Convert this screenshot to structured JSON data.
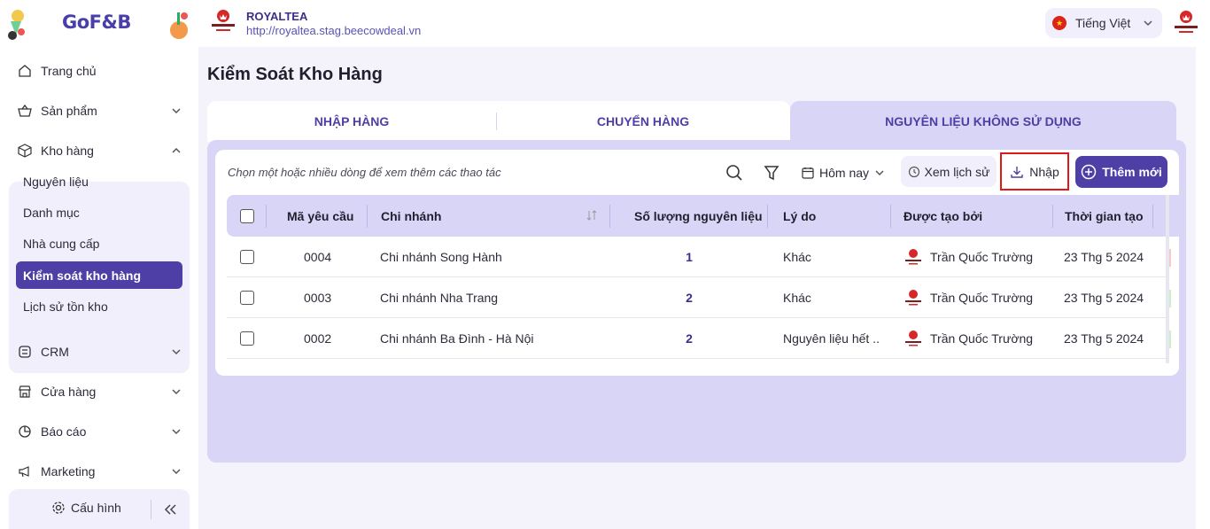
{
  "header": {
    "app_name": "GoF&B",
    "store_name": "ROYALTEA",
    "store_url": "http://royaltea.stag.beecowdeal.vn",
    "language": "Tiếng Việt"
  },
  "sidebar": {
    "items": [
      {
        "label": "Trang chủ",
        "icon": "home-icon"
      },
      {
        "label": "Sản phẩm",
        "icon": "basket-icon"
      },
      {
        "label": "Kho hàng",
        "icon": "box-icon"
      },
      {
        "label": "CRM",
        "icon": "crm-icon"
      },
      {
        "label": "Cửa hàng",
        "icon": "store-icon"
      },
      {
        "label": "Báo cáo",
        "icon": "pie-chart-icon"
      },
      {
        "label": "Marketing",
        "icon": "megaphone-icon"
      }
    ],
    "kho_sub": [
      {
        "label": "Nguyên liệu"
      },
      {
        "label": "Danh mục"
      },
      {
        "label": "Nhà cung cấp"
      },
      {
        "label": "Kiểm soát kho hàng"
      },
      {
        "label": "Lịch sử tồn kho"
      }
    ],
    "config_label": "Cấu hình"
  },
  "main": {
    "title": "Kiểm Soát Kho Hàng",
    "tabs": [
      {
        "label": "NHẬP HÀNG"
      },
      {
        "label": "CHUYỂN HÀNG"
      },
      {
        "label": "NGUYÊN LIỆU KHÔNG SỬ DỤNG"
      }
    ],
    "toolbar": {
      "hint": "Chọn một hoặc nhiều dòng để xem thêm các thao tác",
      "date_filter": "Hôm nay",
      "history_label": "Xem lịch sử",
      "import_label": "Nhập",
      "add_label": "Thêm mới"
    },
    "table": {
      "headers": [
        "Mã yêu cầu",
        "Chi nhánh",
        "Số lượng nguyên liệu",
        "Lý do",
        "Được tạo bởi",
        "Thời gian tạo"
      ],
      "rows": [
        {
          "code": "0004",
          "branch": "Chi nhánh Song Hành",
          "qty": "1",
          "reason": "Khác",
          "creator": "Trần Quốc Trường",
          "time": "23 Thg 5 2024",
          "status_color": "#f7c9c9"
        },
        {
          "code": "0003",
          "branch": "Chi nhánh Nha Trang",
          "qty": "2",
          "reason": "Khác",
          "creator": "Trần Quốc Trường",
          "time": "23 Thg 5 2024",
          "status_color": "#c8f0cf"
        },
        {
          "code": "0002",
          "branch": "Chi nhánh Ba Đình - Hà Nội",
          "qty": "2",
          "reason": "Nguyên liệu hết ...",
          "creator": "Trần Quốc Trường",
          "time": "23 Thg 5 2024",
          "status_color": "#c8f0cf"
        }
      ]
    }
  },
  "colors": {
    "brand": "#4e3fa6",
    "lavender": "#d9d5f7",
    "highlight": "#e01818"
  }
}
